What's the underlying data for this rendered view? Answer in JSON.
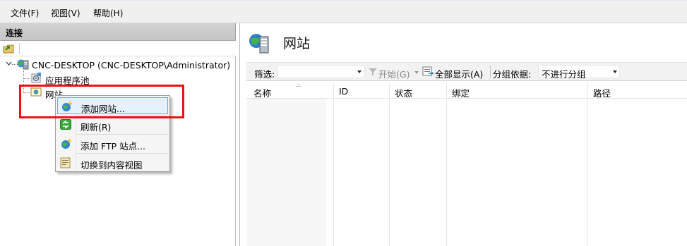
{
  "menubar": {
    "items": [
      {
        "label": "文件(F)"
      },
      {
        "label": "视图(V)"
      },
      {
        "label": "帮助(H)"
      }
    ]
  },
  "connections": {
    "header": "连接",
    "tree": {
      "server": "CNC-DESKTOP (CNC-DESKTOP\\Administrator)",
      "app_pools": "应用程序池",
      "sites": "网站"
    }
  },
  "context_menu": {
    "items": [
      {
        "label": "添加网站...",
        "icon": "globe-add-icon"
      },
      {
        "label": "刷新(R)",
        "icon": "refresh-icon"
      },
      {
        "label": "添加 FTP 站点...",
        "icon": "ftp-add-icon"
      },
      {
        "label": "切换到内容视图",
        "icon": "content-view-icon"
      }
    ]
  },
  "sites_page": {
    "title": "网站",
    "filter_label": "筛选:",
    "filter_value": "",
    "start_label": "开始(G)",
    "show_all_label": "全部显示(A)",
    "group_label": "分组依据:",
    "group_value": "不进行分组",
    "columns": [
      "名称",
      "ID",
      "状态",
      "绑定",
      "路径"
    ]
  },
  "colors": {
    "highlight_border": "#ef1111",
    "menu_hover": "#e5f1fb"
  }
}
